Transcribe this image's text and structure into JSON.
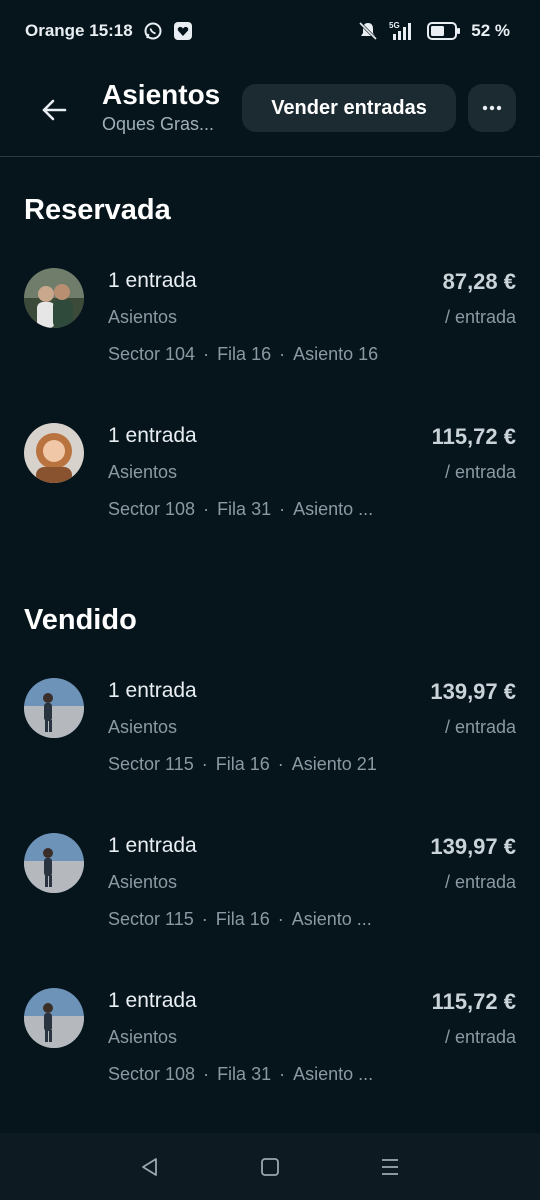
{
  "status_bar": {
    "carrier_time": "Orange 15:18",
    "network": "5G",
    "battery": "52 %",
    "icons": [
      "whatsapp-icon",
      "app-badge-icon",
      "mute-icon",
      "signal-icon",
      "battery-icon"
    ]
  },
  "header": {
    "title": "Asientos",
    "subtitle": "Oques Gras...",
    "sell_label": "Vender entradas",
    "more_label": "···"
  },
  "sections": [
    {
      "title": "Reservada",
      "items": [
        {
          "qty": "1 entrada",
          "kind": "Asientos",
          "sector": "Sector 104",
          "row": "Fila 16",
          "seat": "Asiento 16",
          "price": "87,28 €",
          "per": "/ entrada"
        },
        {
          "qty": "1 entrada",
          "kind": "Asientos",
          "sector": "Sector 108",
          "row": "Fila 31",
          "seat": "Asiento ...",
          "price": "115,72 €",
          "per": "/ entrada"
        }
      ]
    },
    {
      "title": "Vendido",
      "items": [
        {
          "qty": "1 entrada",
          "kind": "Asientos",
          "sector": "Sector 115",
          "row": "Fila 16",
          "seat": "Asiento 21",
          "price": "139,97 €",
          "per": "/ entrada"
        },
        {
          "qty": "1 entrada",
          "kind": "Asientos",
          "sector": "Sector 115",
          "row": "Fila 16",
          "seat": "Asiento ...",
          "price": "139,97 €",
          "per": "/ entrada"
        },
        {
          "qty": "1 entrada",
          "kind": "Asientos",
          "sector": "Sector 108",
          "row": "Fila 31",
          "seat": "Asiento ...",
          "price": "115,72 €",
          "per": "/ entrada"
        }
      ]
    }
  ],
  "separator": "·",
  "colors": {
    "background": "#06141c",
    "button": "#1c2a31",
    "muted_text": "#8a9aa2"
  }
}
